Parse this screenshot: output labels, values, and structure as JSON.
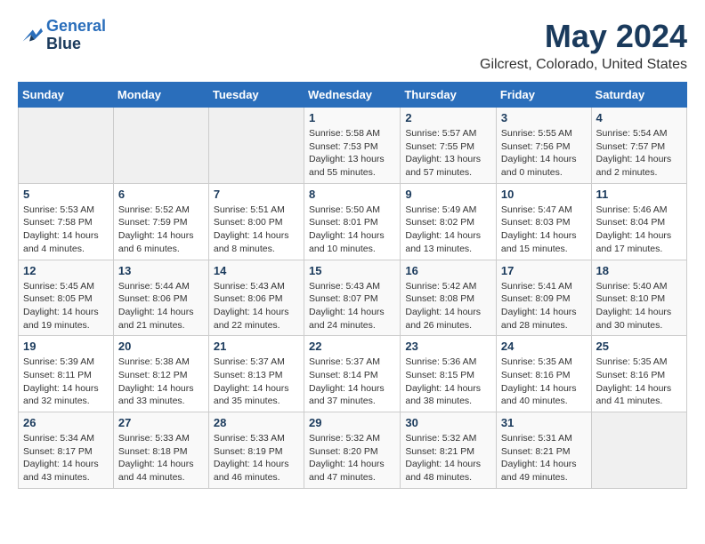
{
  "header": {
    "logo_line1": "General",
    "logo_line2": "Blue",
    "month": "May 2024",
    "location": "Gilcrest, Colorado, United States"
  },
  "weekdays": [
    "Sunday",
    "Monday",
    "Tuesday",
    "Wednesday",
    "Thursday",
    "Friday",
    "Saturday"
  ],
  "weeks": [
    [
      {
        "day": "",
        "info": ""
      },
      {
        "day": "",
        "info": ""
      },
      {
        "day": "",
        "info": ""
      },
      {
        "day": "1",
        "info": "Sunrise: 5:58 AM\nSunset: 7:53 PM\nDaylight: 13 hours\nand 55 minutes."
      },
      {
        "day": "2",
        "info": "Sunrise: 5:57 AM\nSunset: 7:55 PM\nDaylight: 13 hours\nand 57 minutes."
      },
      {
        "day": "3",
        "info": "Sunrise: 5:55 AM\nSunset: 7:56 PM\nDaylight: 14 hours\nand 0 minutes."
      },
      {
        "day": "4",
        "info": "Sunrise: 5:54 AM\nSunset: 7:57 PM\nDaylight: 14 hours\nand 2 minutes."
      }
    ],
    [
      {
        "day": "5",
        "info": "Sunrise: 5:53 AM\nSunset: 7:58 PM\nDaylight: 14 hours\nand 4 minutes."
      },
      {
        "day": "6",
        "info": "Sunrise: 5:52 AM\nSunset: 7:59 PM\nDaylight: 14 hours\nand 6 minutes."
      },
      {
        "day": "7",
        "info": "Sunrise: 5:51 AM\nSunset: 8:00 PM\nDaylight: 14 hours\nand 8 minutes."
      },
      {
        "day": "8",
        "info": "Sunrise: 5:50 AM\nSunset: 8:01 PM\nDaylight: 14 hours\nand 10 minutes."
      },
      {
        "day": "9",
        "info": "Sunrise: 5:49 AM\nSunset: 8:02 PM\nDaylight: 14 hours\nand 13 minutes."
      },
      {
        "day": "10",
        "info": "Sunrise: 5:47 AM\nSunset: 8:03 PM\nDaylight: 14 hours\nand 15 minutes."
      },
      {
        "day": "11",
        "info": "Sunrise: 5:46 AM\nSunset: 8:04 PM\nDaylight: 14 hours\nand 17 minutes."
      }
    ],
    [
      {
        "day": "12",
        "info": "Sunrise: 5:45 AM\nSunset: 8:05 PM\nDaylight: 14 hours\nand 19 minutes."
      },
      {
        "day": "13",
        "info": "Sunrise: 5:44 AM\nSunset: 8:06 PM\nDaylight: 14 hours\nand 21 minutes."
      },
      {
        "day": "14",
        "info": "Sunrise: 5:43 AM\nSunset: 8:06 PM\nDaylight: 14 hours\nand 22 minutes."
      },
      {
        "day": "15",
        "info": "Sunrise: 5:43 AM\nSunset: 8:07 PM\nDaylight: 14 hours\nand 24 minutes."
      },
      {
        "day": "16",
        "info": "Sunrise: 5:42 AM\nSunset: 8:08 PM\nDaylight: 14 hours\nand 26 minutes."
      },
      {
        "day": "17",
        "info": "Sunrise: 5:41 AM\nSunset: 8:09 PM\nDaylight: 14 hours\nand 28 minutes."
      },
      {
        "day": "18",
        "info": "Sunrise: 5:40 AM\nSunset: 8:10 PM\nDaylight: 14 hours\nand 30 minutes."
      }
    ],
    [
      {
        "day": "19",
        "info": "Sunrise: 5:39 AM\nSunset: 8:11 PM\nDaylight: 14 hours\nand 32 minutes."
      },
      {
        "day": "20",
        "info": "Sunrise: 5:38 AM\nSunset: 8:12 PM\nDaylight: 14 hours\nand 33 minutes."
      },
      {
        "day": "21",
        "info": "Sunrise: 5:37 AM\nSunset: 8:13 PM\nDaylight: 14 hours\nand 35 minutes."
      },
      {
        "day": "22",
        "info": "Sunrise: 5:37 AM\nSunset: 8:14 PM\nDaylight: 14 hours\nand 37 minutes."
      },
      {
        "day": "23",
        "info": "Sunrise: 5:36 AM\nSunset: 8:15 PM\nDaylight: 14 hours\nand 38 minutes."
      },
      {
        "day": "24",
        "info": "Sunrise: 5:35 AM\nSunset: 8:16 PM\nDaylight: 14 hours\nand 40 minutes."
      },
      {
        "day": "25",
        "info": "Sunrise: 5:35 AM\nSunset: 8:16 PM\nDaylight: 14 hours\nand 41 minutes."
      }
    ],
    [
      {
        "day": "26",
        "info": "Sunrise: 5:34 AM\nSunset: 8:17 PM\nDaylight: 14 hours\nand 43 minutes."
      },
      {
        "day": "27",
        "info": "Sunrise: 5:33 AM\nSunset: 8:18 PM\nDaylight: 14 hours\nand 44 minutes."
      },
      {
        "day": "28",
        "info": "Sunrise: 5:33 AM\nSunset: 8:19 PM\nDaylight: 14 hours\nand 46 minutes."
      },
      {
        "day": "29",
        "info": "Sunrise: 5:32 AM\nSunset: 8:20 PM\nDaylight: 14 hours\nand 47 minutes."
      },
      {
        "day": "30",
        "info": "Sunrise: 5:32 AM\nSunset: 8:21 PM\nDaylight: 14 hours\nand 48 minutes."
      },
      {
        "day": "31",
        "info": "Sunrise: 5:31 AM\nSunset: 8:21 PM\nDaylight: 14 hours\nand 49 minutes."
      },
      {
        "day": "",
        "info": ""
      }
    ]
  ]
}
